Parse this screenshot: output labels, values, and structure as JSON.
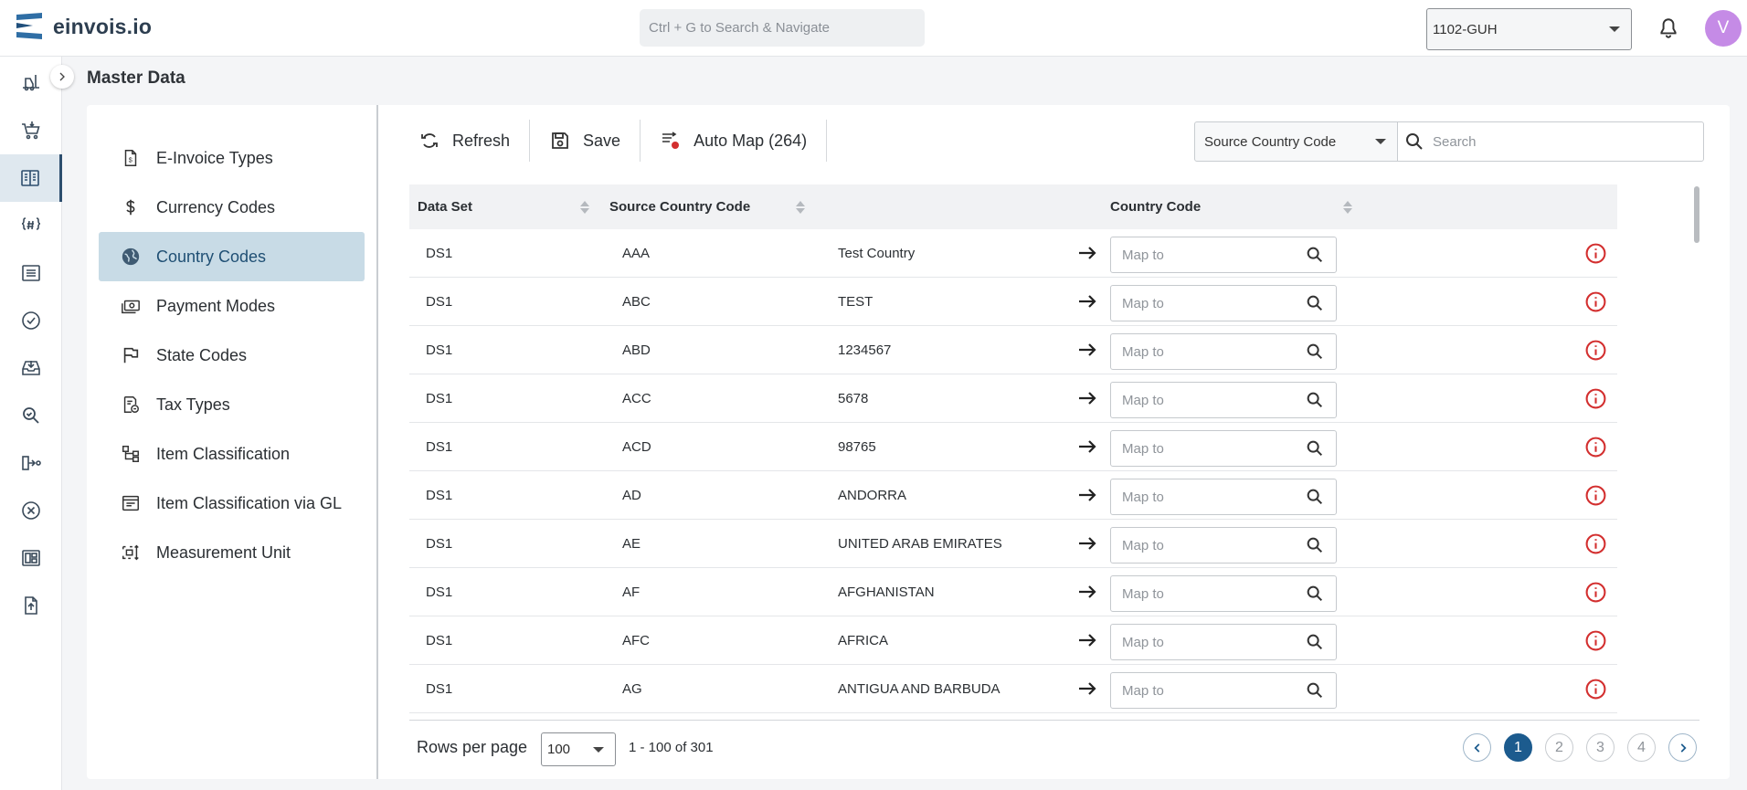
{
  "app": {
    "name": "einvois.io"
  },
  "header": {
    "search_placeholder": "Ctrl + G to Search & Navigate",
    "entity": "1102-GUH",
    "avatar_initial": "V"
  },
  "page": {
    "title": "Master Data"
  },
  "submenu": {
    "items": [
      {
        "label": "E-Invoice Types"
      },
      {
        "label": "Currency Codes"
      },
      {
        "label": "Country Codes"
      },
      {
        "label": "Payment Modes"
      },
      {
        "label": "State Codes"
      },
      {
        "label": "Tax Types"
      },
      {
        "label": "Item Classification"
      },
      {
        "label": "Item Classification via GL"
      },
      {
        "label": "Measurement Unit"
      }
    ],
    "active_index": 2
  },
  "toolbar": {
    "refresh_label": "Refresh",
    "save_label": "Save",
    "automap_label": "Auto Map (264)",
    "filter_value": "Source Country Code",
    "search_placeholder": "Search"
  },
  "table": {
    "headers": {
      "data_set": "Data Set",
      "source_code": "Source Country Code",
      "country_code": "Country Code"
    },
    "map_placeholder": "Map to",
    "rows": [
      {
        "data_set": "DS1",
        "code": "AAA",
        "name": "Test Country"
      },
      {
        "data_set": "DS1",
        "code": "ABC",
        "name": "TEST"
      },
      {
        "data_set": "DS1",
        "code": "ABD",
        "name": "1234567"
      },
      {
        "data_set": "DS1",
        "code": "ACC",
        "name": "5678"
      },
      {
        "data_set": "DS1",
        "code": "ACD",
        "name": "98765"
      },
      {
        "data_set": "DS1",
        "code": "AD",
        "name": "ANDORRA"
      },
      {
        "data_set": "DS1",
        "code": "AE",
        "name": "UNITED ARAB EMIRATES"
      },
      {
        "data_set": "DS1",
        "code": "AF",
        "name": "AFGHANISTAN"
      },
      {
        "data_set": "DS1",
        "code": "AFC",
        "name": "AFRICA"
      },
      {
        "data_set": "DS1",
        "code": "AG",
        "name": "ANTIGUA AND BARBUDA"
      }
    ]
  },
  "footer": {
    "rows_per_page_label": "Rows per page",
    "rows_per_page": "100",
    "range": "1 - 100 of 301",
    "pages": [
      "1",
      "2",
      "3",
      "4"
    ],
    "current_page": "1"
  },
  "colors": {
    "accent": "#1c5b8e",
    "active_menu_bg": "#c8dbe6",
    "info_red": "#d32f2f",
    "avatar": "#c58be6"
  }
}
